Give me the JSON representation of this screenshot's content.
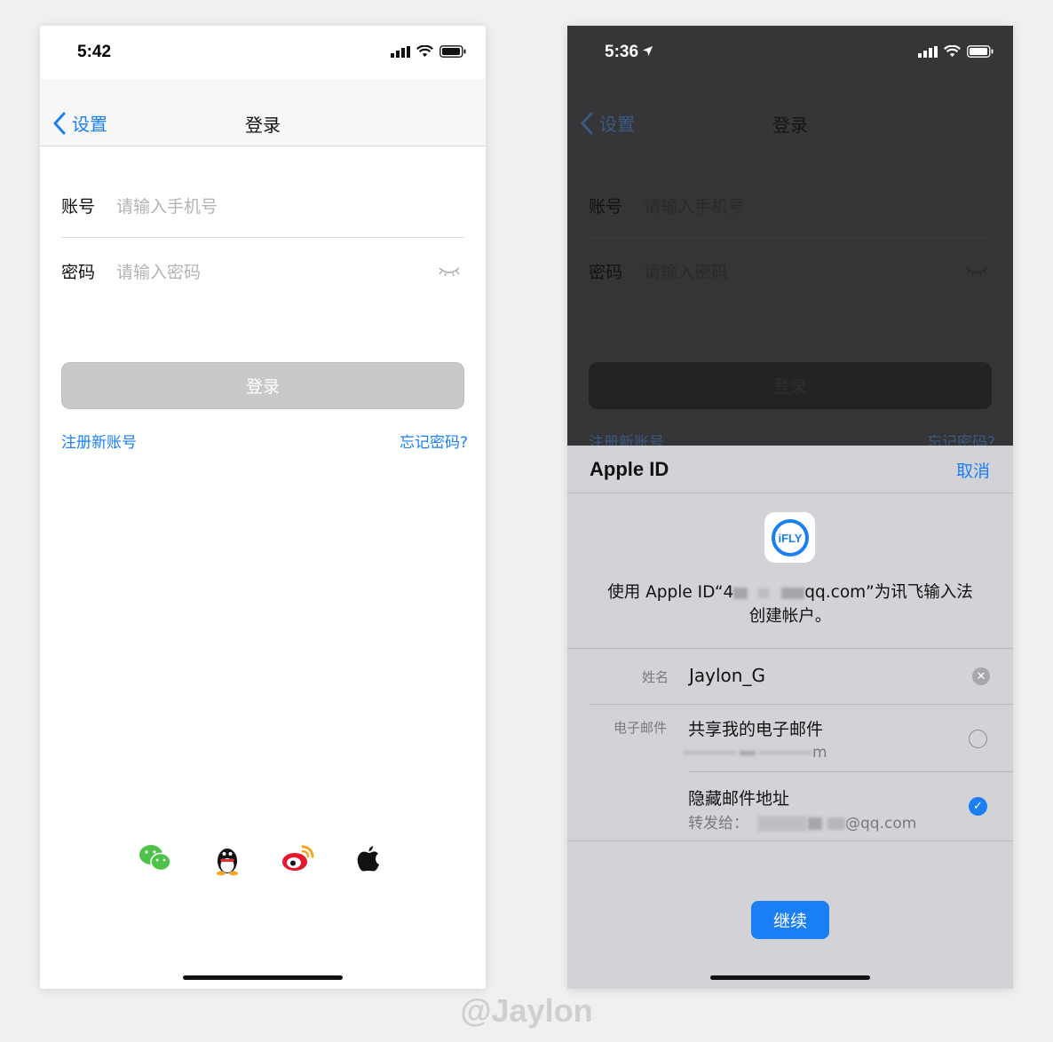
{
  "left_phone": {
    "status": {
      "time": "5:42"
    },
    "nav": {
      "back_label": "设置",
      "title": "登录"
    },
    "account": {
      "label": "账号",
      "placeholder": "请输入手机号"
    },
    "password": {
      "label": "密码",
      "placeholder": "请输入密码"
    },
    "login_button": "登录",
    "register_link": "注册新账号",
    "forgot_link": "忘记密码?",
    "social_icons": [
      "wechat-icon",
      "qq-icon",
      "weibo-icon",
      "apple-icon"
    ]
  },
  "right_phone": {
    "status": {
      "time": "5:36"
    },
    "nav": {
      "back_label": "设置",
      "title": "登录"
    },
    "account": {
      "label": "账号",
      "placeholder": "请输入手机号"
    },
    "password": {
      "label": "密码",
      "placeholder": "请输入密码"
    },
    "login_button": "登录",
    "register_link": "注册新账号",
    "forgot_link": "忘记密码?",
    "sheet": {
      "title": "Apple ID",
      "cancel": "取消",
      "app_icon_text": "iFLY",
      "description_prefix": "使用 Apple ID“4",
      "description_suffix": "qq.com”为讯飞输入法",
      "description_line2": "创建帐户。",
      "name_label": "姓名",
      "name_value": "Jaylon_G",
      "email_label": "电子邮件",
      "share_email_option": "共享我的电子邮件",
      "share_email_partial": "m",
      "hide_email_option": "隐藏邮件地址",
      "forward_to_label": "转发给：",
      "forward_to_partial": "@qq.com",
      "continue_button": "继续"
    }
  },
  "watermark": "@Jaylon",
  "colors": {
    "accent": "#1a7ff5",
    "wechat": "#4fc24a",
    "weibo": "#e6162d",
    "dark_overlay": "#363538",
    "sheet_bg": "#d3d3d7"
  }
}
